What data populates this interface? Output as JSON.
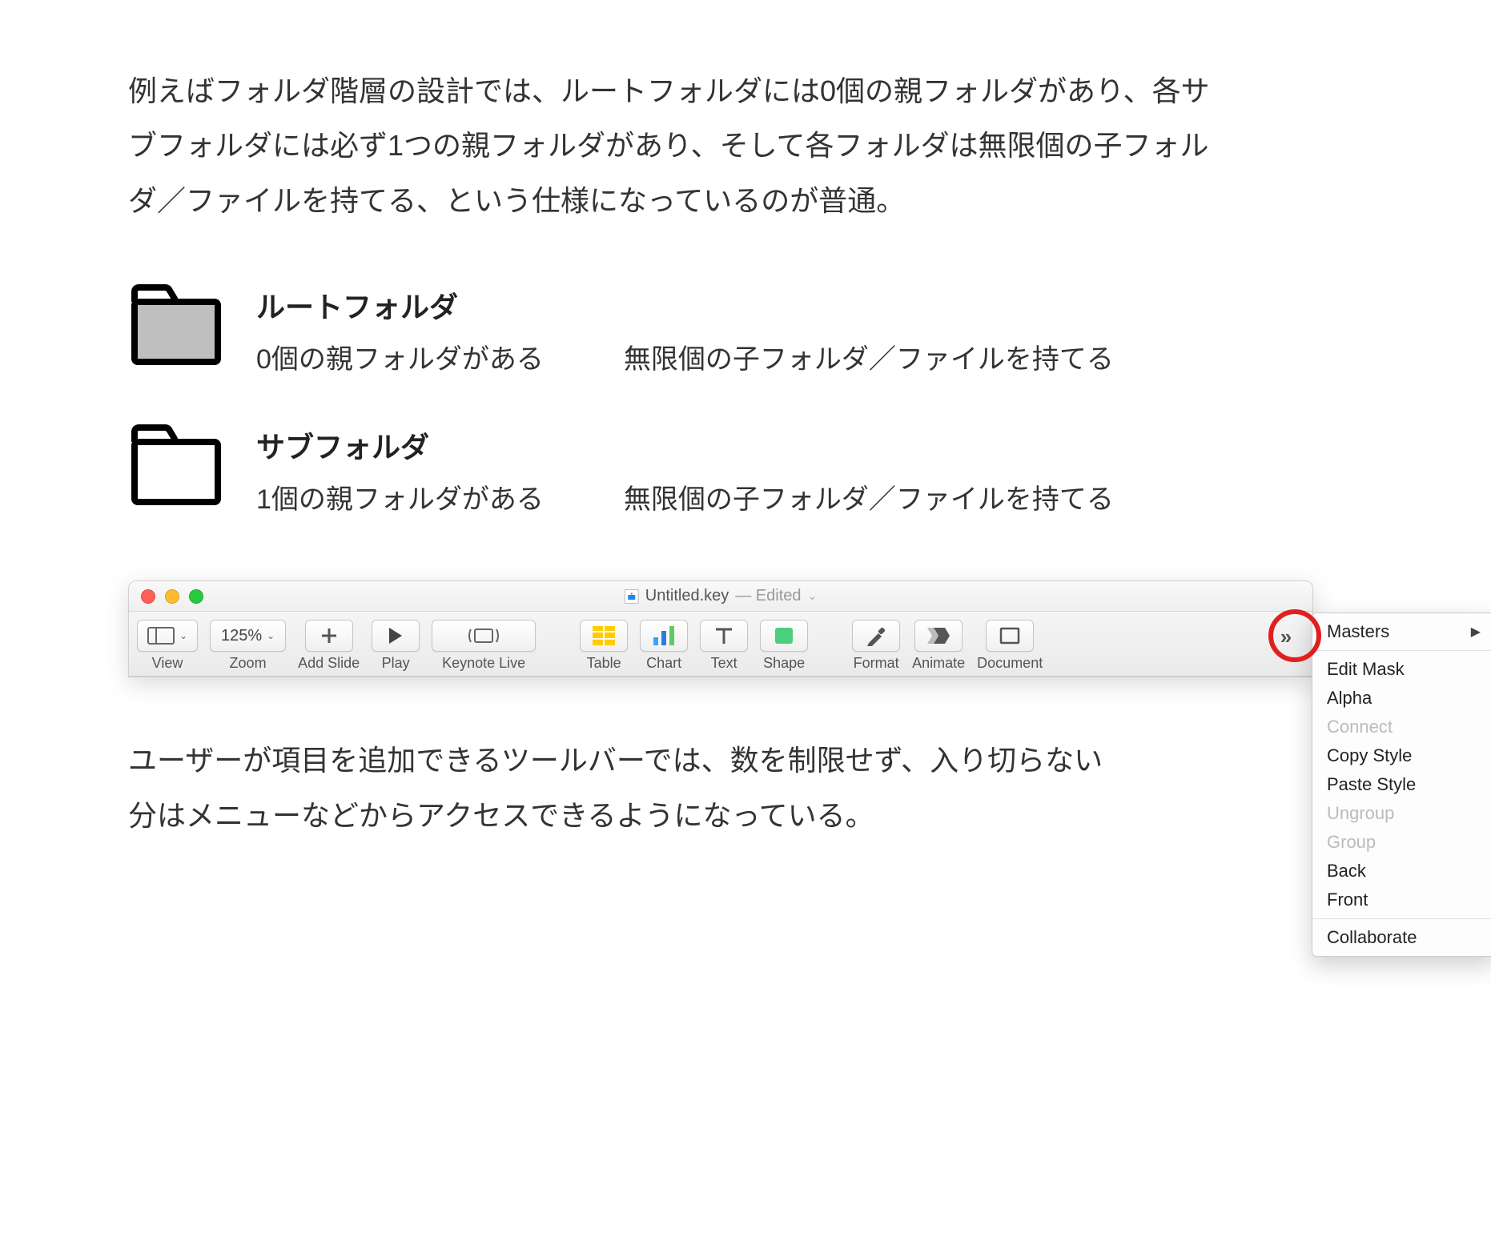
{
  "intro": "例えばフォルダ階層の設計では、ルートフォルダには0個の親フォルダがあり、各サブフォルダには必ず1つの親フォルダがあり、そして各フォルダは無限個の子フォルダ／ファイルを持てる、という仕様になっているのが普通。",
  "folders": [
    {
      "title": "ルートフォルダ",
      "parent": "0個の親フォルダがある",
      "children": "無限個の子フォルダ／ファイルを持てる",
      "filled": true
    },
    {
      "title": "サブフォルダ",
      "parent": "1個の親フォルダがある",
      "children": "無限個の子フォルダ／ファイルを持てる",
      "filled": false
    }
  ],
  "window": {
    "filename": "Untitled.key",
    "status": "— Edited"
  },
  "toolbar": {
    "items": [
      {
        "id": "view",
        "label": "View"
      },
      {
        "id": "zoom",
        "label": "Zoom",
        "value": "125%"
      },
      {
        "id": "add-slide",
        "label": "Add Slide"
      },
      {
        "id": "play",
        "label": "Play"
      },
      {
        "id": "keynote-live",
        "label": "Keynote Live"
      },
      {
        "id": "table",
        "label": "Table"
      },
      {
        "id": "chart",
        "label": "Chart"
      },
      {
        "id": "text",
        "label": "Text"
      },
      {
        "id": "shape",
        "label": "Shape"
      },
      {
        "id": "format",
        "label": "Format"
      },
      {
        "id": "animate",
        "label": "Animate"
      },
      {
        "id": "document",
        "label": "Document"
      }
    ],
    "overflow_glyph": "»"
  },
  "overflow_menu": [
    {
      "label": "Masters",
      "submenu": true
    },
    {
      "sep": true
    },
    {
      "label": "Edit Mask"
    },
    {
      "label": "Alpha"
    },
    {
      "label": "Connect",
      "disabled": true
    },
    {
      "label": "Copy Style"
    },
    {
      "label": "Paste Style"
    },
    {
      "label": "Ungroup",
      "disabled": true
    },
    {
      "label": "Group",
      "disabled": true
    },
    {
      "label": "Back"
    },
    {
      "label": "Front"
    },
    {
      "sep": true
    },
    {
      "label": "Collaborate"
    }
  ],
  "caption": "ユーザーが項目を追加できるツールバーでは、数を制限せず、入り切らない分はメニューなどからアクセスできるようになっている。"
}
